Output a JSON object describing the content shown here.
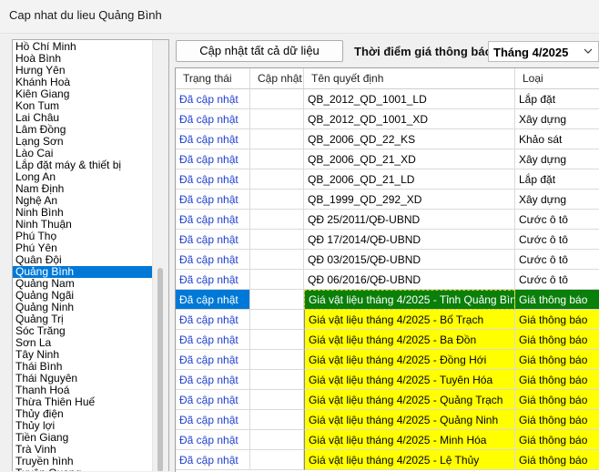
{
  "window": {
    "title": "Cap nhat du lieu Quảng Bình"
  },
  "provinces": {
    "items": [
      "Hồ Chí Minh",
      "Hoà Bình",
      "Hưng Yên",
      "Khánh Hoà",
      "Kiên Giang",
      "Kon Tum",
      "Lai Châu",
      "Lâm Đồng",
      "Lạng Sơn",
      "Lào Cai",
      "Lắp đặt máy & thiết bị",
      "Long An",
      "Nam Định",
      "Nghệ An",
      "Ninh Bình",
      "Ninh Thuận",
      "Phú Thọ",
      "Phú Yên",
      "Quân Đội",
      "Quảng Bình",
      "Quảng Nam",
      "Quảng Ngãi",
      "Quảng Ninh",
      "Quảng Trị",
      "Sóc Trăng",
      "Sơn La",
      "Tây Ninh",
      "Thái Bình",
      "Thái Nguyên",
      "Thanh Hoá",
      "Thừa Thiên Huế",
      "Thủy điện",
      "Thủy lợi",
      "Tiền Giang",
      "Trà Vinh",
      "Truyền hình",
      "Tuyên Quang"
    ],
    "selected": "Quảng Bình"
  },
  "toolbar": {
    "update_all_label": "Cập nhật tất cả dữ liệu",
    "time_label": "Thời điểm giá thông báo",
    "month_value": "Tháng 4/2025"
  },
  "table": {
    "columns": [
      "Trạng thái",
      "Cập nhật",
      "Tên quyết định",
      "Loại"
    ],
    "rows": [
      {
        "status": "Đã cập nhật",
        "update": "",
        "name": "QB_2012_QD_1001_LD",
        "type": "Lắp đặt",
        "style": ""
      },
      {
        "status": "Đã cập nhật",
        "update": "",
        "name": "QB_2012_QD_1001_XD",
        "type": "Xây dựng",
        "style": ""
      },
      {
        "status": "Đã cập nhật",
        "update": "",
        "name": "QB_2006_QD_22_KS",
        "type": "Khảo sát",
        "style": ""
      },
      {
        "status": "Đã cập nhật",
        "update": "",
        "name": "QB_2006_QD_21_XD",
        "type": "Xây dựng",
        "style": ""
      },
      {
        "status": "Đã cập nhật",
        "update": "",
        "name": "QB_2006_QD_21_LD",
        "type": "Lắp đặt",
        "style": ""
      },
      {
        "status": "Đã cập nhật",
        "update": "",
        "name": "QB_1999_QD_292_XD",
        "type": "Xây dựng",
        "style": ""
      },
      {
        "status": "Đã cập nhật",
        "update": "",
        "name": "QĐ 25/2011/QĐ-UBND",
        "type": "Cước ô tô",
        "style": ""
      },
      {
        "status": "Đã cập nhật",
        "update": "",
        "name": "QĐ 17/2014/QĐ-UBND",
        "type": "Cước ô tô",
        "style": ""
      },
      {
        "status": "Đã cập nhật",
        "update": "",
        "name": "QĐ 03/2015/QĐ-UBND",
        "type": "Cước ô tô",
        "style": ""
      },
      {
        "status": "Đã cập nhật",
        "update": "",
        "name": "QĐ 06/2016/QĐ-UBND",
        "type": "Cước ô tô",
        "style": ""
      },
      {
        "status": "Đã cập nhật",
        "update": "",
        "name": "Giá vật liệu tháng 4/2025 - Tỉnh Quảng Bình",
        "type": "Giá thông báo",
        "style": "sel cur"
      },
      {
        "status": "Đã cập nhật",
        "update": "",
        "name": "Giá vật liệu tháng 4/2025 - Bố Trạch",
        "type": "Giá thông báo",
        "style": "yel"
      },
      {
        "status": "Đã cập nhật",
        "update": "",
        "name": "Giá vật liệu tháng 4/2025 - Ba Đồn",
        "type": "Giá thông báo",
        "style": "yel"
      },
      {
        "status": "Đã cập nhật",
        "update": "",
        "name": "Giá vật liệu tháng 4/2025 - Đồng Hới",
        "type": "Giá thông báo",
        "style": "yel"
      },
      {
        "status": "Đã cập nhật",
        "update": "",
        "name": "Giá vật liệu tháng 4/2025 - Tuyên Hóa",
        "type": "Giá thông báo",
        "style": "yel"
      },
      {
        "status": "Đã cập nhật",
        "update": "",
        "name": "Giá vật liệu tháng 4/2025 - Quảng Trạch",
        "type": "Giá thông báo",
        "style": "yel"
      },
      {
        "status": "Đã cập nhật",
        "update": "",
        "name": "Giá vật liệu tháng 4/2025 - Quảng Ninh",
        "type": "Giá thông báo",
        "style": "yel"
      },
      {
        "status": "Đã cập nhật",
        "update": "",
        "name": "Giá vật liệu tháng 4/2025 - Minh Hóa",
        "type": "Giá thông báo",
        "style": "yel"
      },
      {
        "status": "Đã cập nhật",
        "update": "",
        "name": "Giá vật liệu tháng 4/2025 - Lệ Thủy",
        "type": "Giá thông báo",
        "style": "yel"
      }
    ]
  },
  "colors": {
    "selection": "#0078d7",
    "status_text": "#1f3fd0",
    "highlight_yellow": "#ffff00",
    "current_green": "#0a7f0a"
  },
  "icons": {
    "dropdown": "chevron-down-icon"
  }
}
